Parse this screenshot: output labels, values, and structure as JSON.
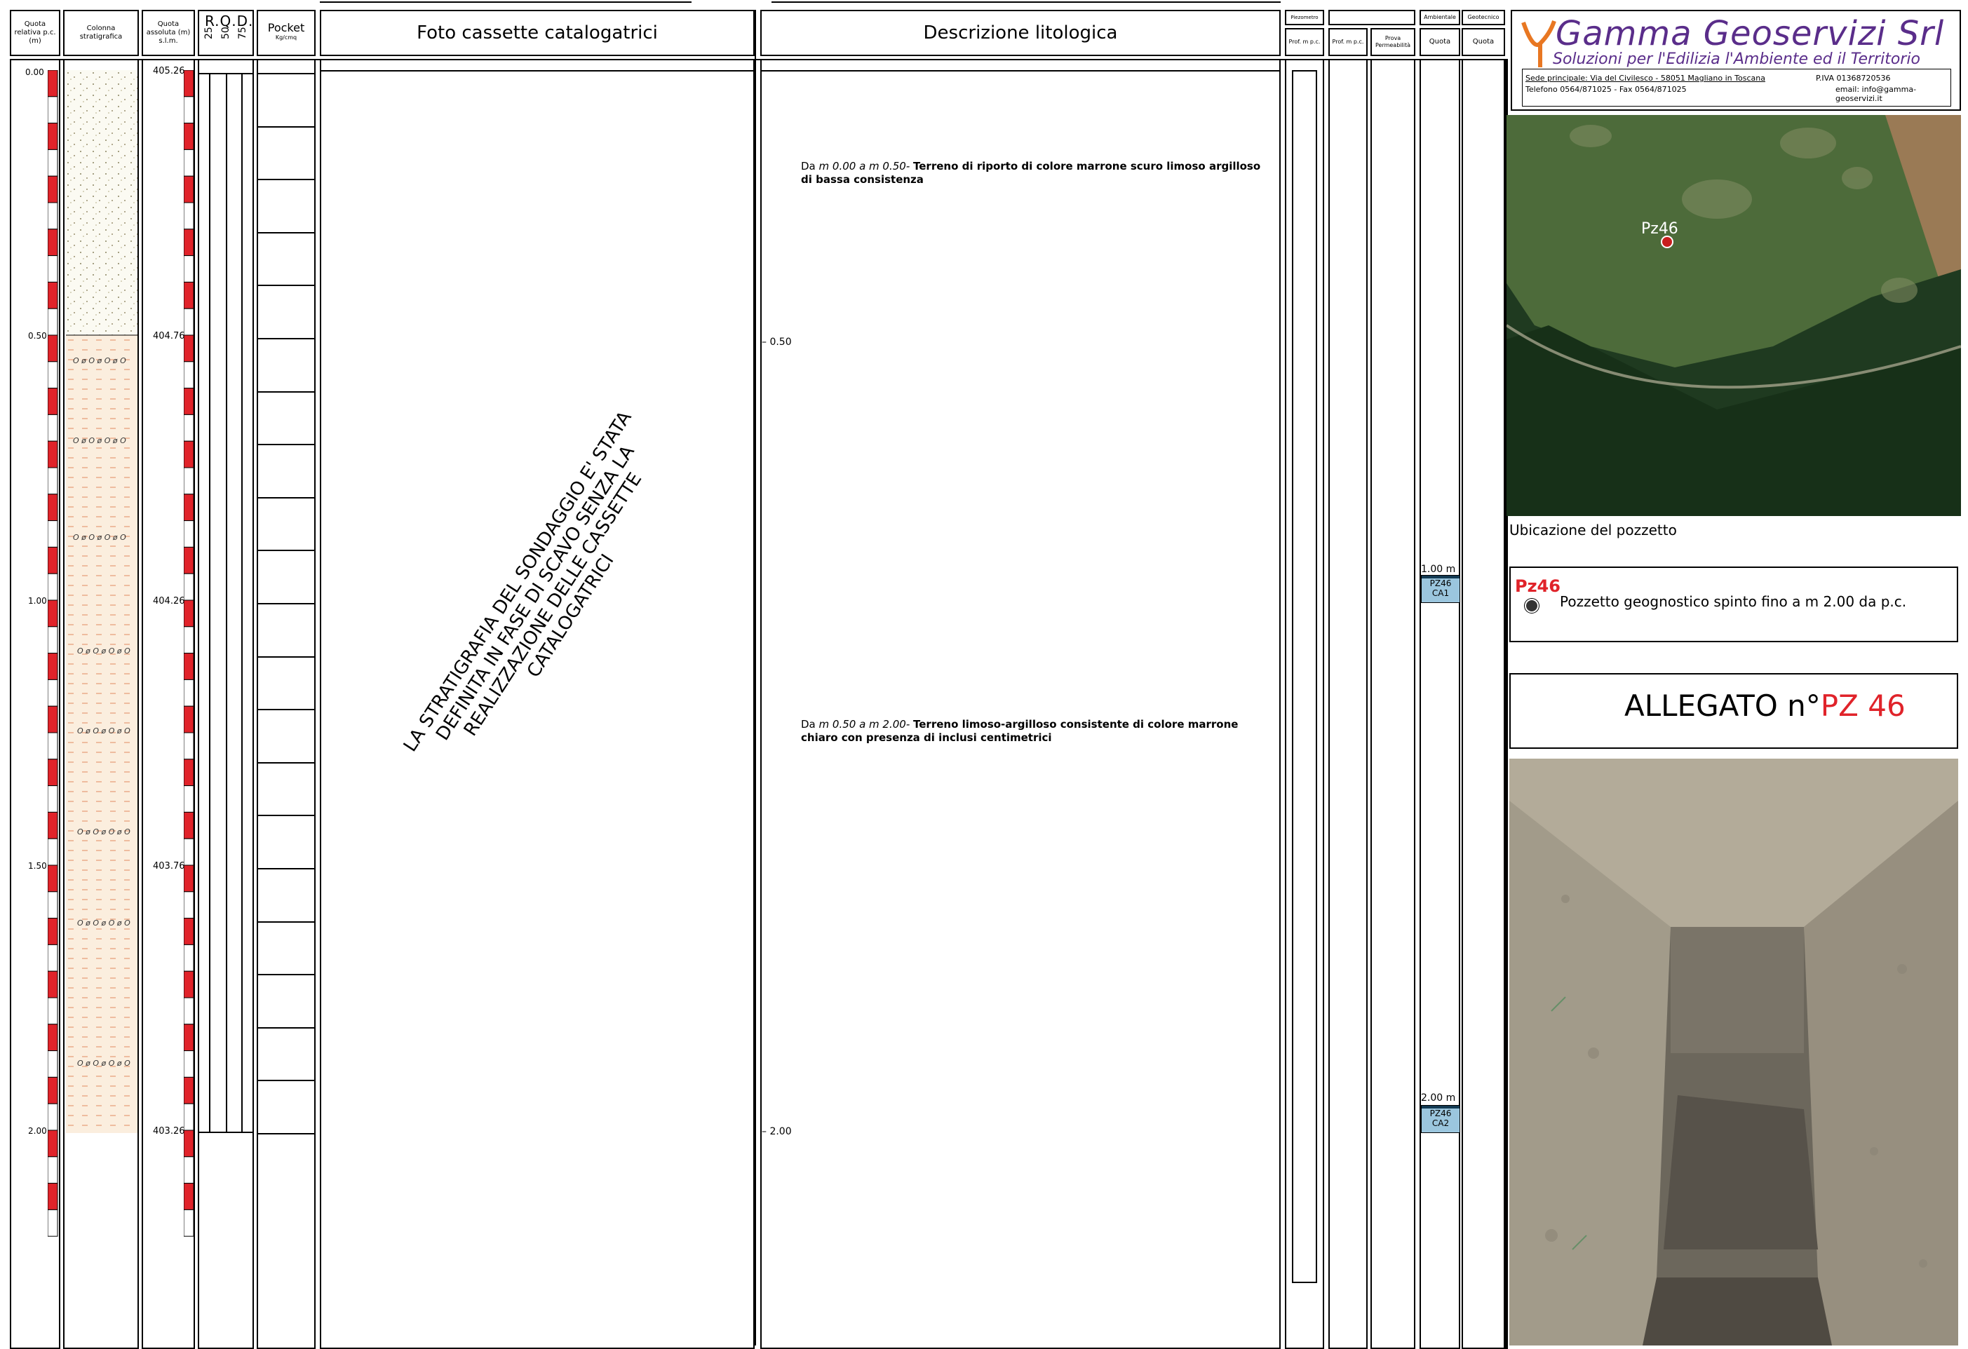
{
  "headers": {
    "quota_relativa": "Quota relativa p.c. (m)",
    "colonna": "Colonna stratigrafica",
    "quota_assoluta": "Quota assoluta (m) s.l.m.",
    "rqd": "R.Q.D.",
    "rqd_ticks": [
      "25",
      "50",
      "75"
    ],
    "pocket": "Pocket",
    "pocket_unit": "Kg/cmq",
    "foto": "Foto cassette catalogatrici",
    "descrizione": "Descrizione litologica",
    "piezometro": "Piezometro",
    "prof_1": "Prof. m p.c.",
    "prof_2": "Prof. m p.c.",
    "prova_perm": "Prova Permeabilità",
    "ambientale": "Ambientale",
    "geotecnico": "Geotecnico",
    "quota_1": "Quota",
    "quota_2": "Quota"
  },
  "depth_labels": [
    "0.00",
    "0.50",
    "1.00",
    "1.50",
    "2.00"
  ],
  "abs_labels": [
    "405.26",
    "404.76",
    "404.26",
    "403.76",
    "403.26"
  ],
  "desc_depth_marks": [
    "0.50",
    "2.00"
  ],
  "lithology": [
    {
      "prefix": "Da",
      "from": "m 0.00 a m 0.50-",
      "text": "Terreno di riporto di colore marrone scuro limoso argilloso di bassa consistenza"
    },
    {
      "prefix": "Da",
      "from": "m 0.50 a m 2.00-",
      "text": "Terreno limoso-argilloso consistente di colore marrone chiaro con presenza di inclusi centimetrici"
    }
  ],
  "rotated_note": "LA STRATIGRAFIA DEL SONDAGGIO E' STATA DEFINITA IN FASE DI SCAVO SENZA LA REALIZZAZIONE DELLE CASSETTE CATALOGATRICI",
  "samples": [
    {
      "depth": "1.00 m",
      "label1": "PZ46",
      "label2": "CA1"
    },
    {
      "depth": "2.00 m",
      "label1": "PZ46",
      "label2": "CA2"
    }
  ],
  "company": {
    "name": "Gamma Geoservizi Srl",
    "tagline": "Soluzioni per l'Edilizia l'Ambiente ed il Territorio",
    "address": "Sede principale: Via del Civilesco - 58051 Magliano in Toscana",
    "phone": "Telefono 0564/871025 - Fax 0564/871025",
    "piva": "P.IVA 01368720536",
    "email": "email: info@gamma-geoservizi.it"
  },
  "map": {
    "marker": "Pz46",
    "caption": "Ubicazione del pozzetto"
  },
  "legend": {
    "code": "Pz46",
    "text": "Pozzetto geognostico spinto fino a m 2.00 da p.c."
  },
  "allegato": {
    "prefix": "ALLEGATO n°",
    "code": "PZ 46"
  },
  "colors": {
    "red": "#e0232a",
    "sample_fill": "#9bc6de",
    "sample_dark": "#123a53",
    "brand_purple": "#5a2d8a",
    "brand_orange": "#e87722"
  }
}
